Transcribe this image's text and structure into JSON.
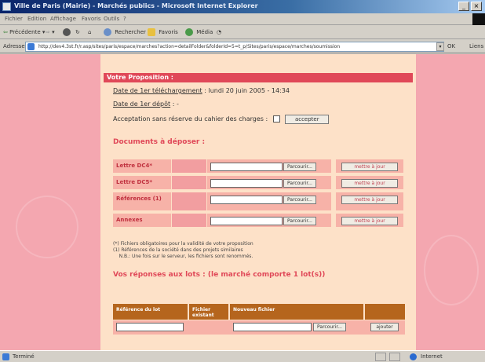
{
  "window": {
    "title": "Ville de Paris (Mairie) - Marchés publics - Microsoft Internet Explorer",
    "min_label": "_",
    "close_label": "×"
  },
  "menu": [
    "Fichier",
    "Edition",
    "Affichage",
    "Favoris",
    "Outils",
    "?"
  ],
  "toolbar": {
    "back": "Précédente",
    "search": "Rechercher",
    "favorites": "Favoris",
    "media": "Média"
  },
  "address": {
    "label": "Adresse",
    "url": "http://dev4.3st.fr/r.asp/sites/paris/espace/marches?action=detailFolder&folderId=5=t_p/Sites/paris/espace/marches/soumission",
    "go": "OK",
    "links": "Liens"
  },
  "page": {
    "section_title": "Votre Proposition :",
    "first_download_label": "Date de 1er téléchargement",
    "first_download_value": ": lundi 20 juin 2005 - 14:34",
    "first_deposit_label": "Date de 1er dépôt",
    "first_deposit_value": ": -",
    "acceptance_text": "Acceptation sans réserve du cahier des charges :",
    "accept_button": "accepter",
    "documents_title": "Documents à déposer :",
    "documents": [
      {
        "label": "Lettre DC4*",
        "browse": "Parcourir...",
        "update": "mettre à jour"
      },
      {
        "label": "Lettre DC5*",
        "browse": "Parcourir...",
        "update": "mettre à jour"
      },
      {
        "label": "Références (1)",
        "browse": "Parcourir...",
        "update": "mettre à jour"
      },
      {
        "label": "Annexes",
        "browse": "Parcourir...",
        "update": "mettre à jour"
      }
    ],
    "notes": "(*) Fichiers obligatoires pour la validité de votre proposition\n(1) Références de la société dans des projets similaires\n    N.B.: Une fois sur le serveur, les fichiers sont renommés.",
    "lots_title": "Vos réponses aux lots : (le marché comporte 1 lot(s))",
    "lots_headers": [
      "Référence du lot",
      "Fichier existant",
      "Nouveau fichier"
    ],
    "lots_browse": "Parcourir...",
    "lots_add": "ajouter"
  },
  "status": {
    "left": "Terminé",
    "right": "Internet"
  }
}
